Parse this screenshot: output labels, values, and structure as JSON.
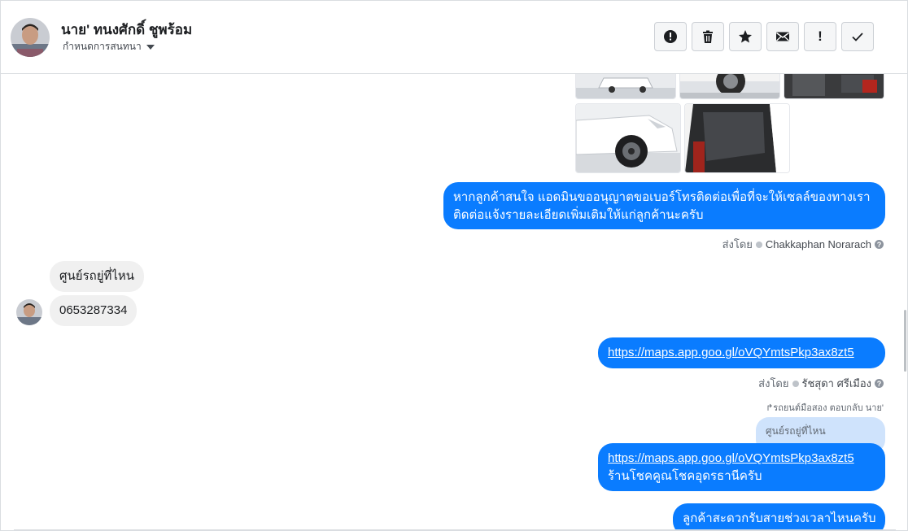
{
  "header": {
    "contact_name": "นาย' ทนงศักดิ์ ชูพร้อม",
    "assign_label": "กำหนดการสนทนา",
    "actions": [
      {
        "name": "spam-icon"
      },
      {
        "name": "trash-icon"
      },
      {
        "name": "star-icon"
      },
      {
        "name": "mail-icon"
      },
      {
        "name": "follow-up-icon",
        "label": "!"
      },
      {
        "name": "check-icon"
      }
    ]
  },
  "messages": {
    "m1": "หากลูกค้าสนใจ แอดมินขออนุญาตขอเบอร์โทรติดต่อเพื่อที่จะให้เซลล์ของทางเรา",
    "m1b": "ติดต่อแจ้งรายละเอียดเพิ่มเติมให้แก่ลูกค้านะครับ",
    "m1_sent_prefix": "ส่งโดย",
    "m1_sender": "Chakkaphan Norarach",
    "in1": "ศูนย์รถยู่ที่ไหน",
    "in2": "0653287334",
    "m2_link": "https://maps.app.goo.gl/oVQYmtsPkp3ax8zt5",
    "m2_sent_prefix": "ส่งโดย",
    "m2_sender": "รัชสุดา ศรีเมือง",
    "reply_note": "รถยนต์มือสอง ตอบกลับ นาย'",
    "reply_quote": "ศูนย์รถยู่ที่ไหน",
    "m3_link": "https://maps.app.goo.gl/oVQYmtsPkp3ax8zt5",
    "m3_text": "ร้านโชคคูณโชคอุดรธานีครับ",
    "m4_partial": "ลูกค้าสะดวกรับสายช่วงเวลาไหนครับ"
  },
  "colors": {
    "outgoing_bubble": "#0a7cff",
    "incoming_bubble": "#f0f0f0",
    "reply_quote_bg": "#cfe3fc"
  }
}
